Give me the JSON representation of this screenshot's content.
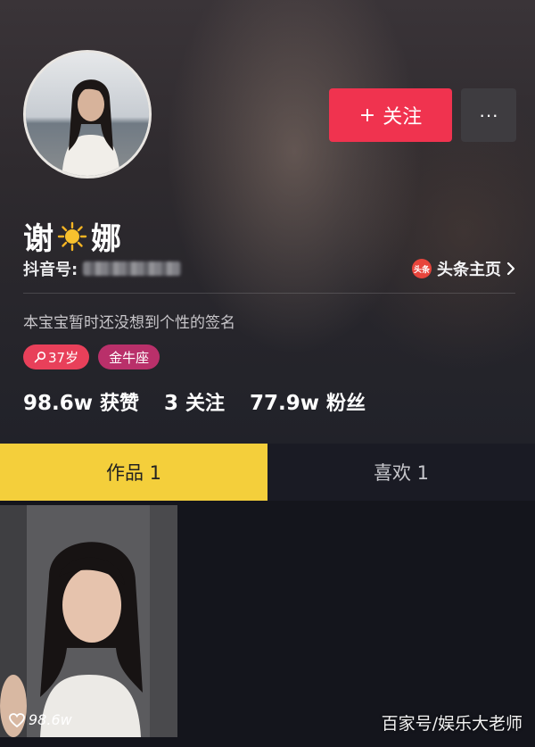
{
  "profile": {
    "name_part1": "谢",
    "name_part2": "娜",
    "name_emoji": "sun-icon",
    "uid_label": "抖音号:",
    "toutiao_badge": "头条",
    "toutiao_link": "头条主页",
    "bio": "本宝宝暂时还没想到个性的签名",
    "tags": {
      "age": "37岁",
      "zodiac": "金牛座"
    }
  },
  "actions": {
    "follow_label": "关注",
    "follow_plus": "+",
    "more_label": "···"
  },
  "stats": {
    "likes_value": "98.6w",
    "likes_label": "获赞",
    "following_value": "3",
    "following_label": "关注",
    "followers_value": "77.9w",
    "followers_label": "粉丝"
  },
  "tabs": {
    "works": "作品 1",
    "likes": "喜欢 1"
  },
  "videos": [
    {
      "likes": "98.6w"
    }
  ],
  "watermark": "百家号/娱乐大老师",
  "colors": {
    "follow": "#f0334f",
    "tab_active": "#f4cf3b",
    "tag_age": "#e8405a",
    "tag_zodiac": "#b9306a"
  }
}
